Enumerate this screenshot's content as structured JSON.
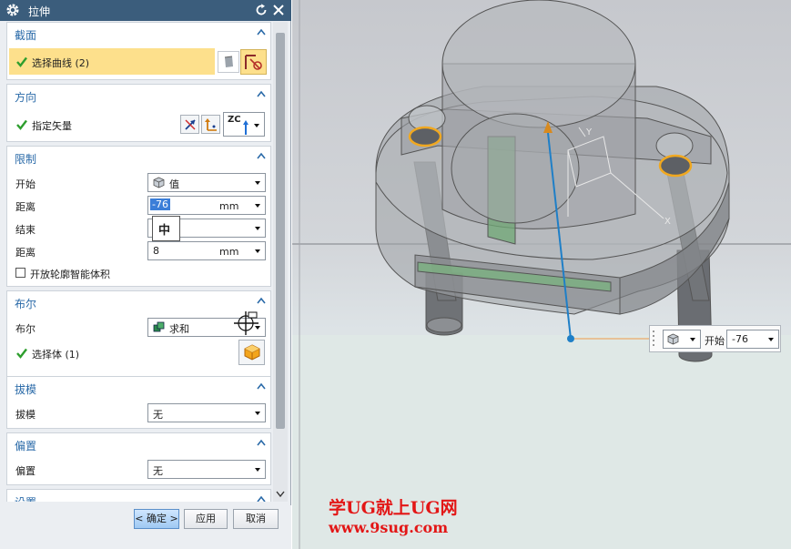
{
  "dialog": {
    "title": "拉伸",
    "sections": {
      "section": {
        "title": "截面",
        "select_curve": "选择曲线 (2)"
      },
      "direction": {
        "title": "方向",
        "specify_vector": "指定矢量",
        "vector_label": "ZC"
      },
      "limits": {
        "title": "限制",
        "start_label": "开始",
        "start_value": "值",
        "distance1_label": "距离",
        "distance1_value": "-76",
        "distance1_unit": "mm",
        "end_label": "结束",
        "ime_indicator": "中",
        "distance2_label": "距离",
        "distance2_value": "8",
        "distance2_unit": "mm",
        "open_profile_label": "开放轮廓智能体积",
        "open_profile_checked": false
      },
      "boolean": {
        "title": "布尔",
        "bool_label": "布尔",
        "bool_value": "求和",
        "select_body": "选择体 (1)"
      },
      "draft": {
        "title": "拔模",
        "draft_label": "拔模",
        "draft_value": "无"
      },
      "offset": {
        "title": "偏置",
        "offset_label": "偏置",
        "offset_value": "无"
      },
      "settings": {
        "title": "设置"
      }
    },
    "buttons": {
      "ok": "< 确定 >",
      "apply": "应用",
      "cancel": "取消"
    }
  },
  "viewport": {
    "coord_bar": {
      "label": "开始",
      "value": "-76"
    },
    "axis_label_y": "Y",
    "axis_label_x": "X"
  },
  "watermark": {
    "line1": "学UG就上UG网",
    "line2": "www.9sug.com"
  },
  "colors": {
    "title_bar": "#3b5d7c",
    "section_title": "#2a6aa8",
    "highlight_row": "#fde08c",
    "check_green": "#2e9e2e",
    "watermark": "#e31616",
    "edge_orange": "#f0a820",
    "vector_blue": "#1f7fc7"
  },
  "icons": [
    "gear-icon",
    "reset-icon",
    "close-icon",
    "check-icon",
    "curve-icon",
    "sketch-icon",
    "reverse-direction-icon",
    "vector-dialog-icon",
    "vector-icon",
    "value-icon",
    "unite-icon",
    "body-select-icon",
    "chevron-up-icon",
    "chevron-down-icon",
    "move-cursor-icon"
  ]
}
